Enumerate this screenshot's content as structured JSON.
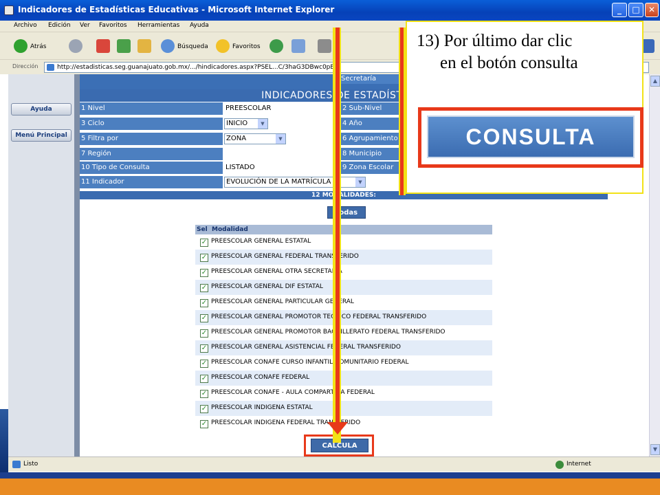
{
  "window": {
    "title": "Indicadores de Estadísticas Educativas - Microsoft Internet Explorer"
  },
  "menu": [
    "Archivo",
    "Edición",
    "Ver",
    "Favoritos",
    "Herramientas",
    "Ayuda"
  ],
  "toolbar": {
    "back": "Atrás",
    "search": "Búsqueda",
    "favorites": "Favoritos"
  },
  "address": {
    "label": "Dirección",
    "url": "http://estadisticas.seg.guanajuato.gob.mx/.../hindicadores.aspx?PSEL...C/3haG3DBwc0pEE"
  },
  "nav": {
    "help": "Ayuda",
    "main_menu": "Menú Principal"
  },
  "page": {
    "secretaria": "Secretaría",
    "header": "INDICADORES DE ESTADÍSTICAS",
    "rows": [
      {
        "label": "1 Nivel",
        "value": "PREESCOLAR",
        "right": "2 Sub-Nivel"
      },
      {
        "label": "3 Ciclo",
        "value": "INICIO",
        "right": "4 Año"
      },
      {
        "label": "5 Filtra por",
        "value": "ZONA",
        "right": "6 Agrupamiento"
      },
      {
        "label": "7 Región",
        "value": "",
        "right": "8 Municipio"
      },
      {
        "label": "10 Tipo de Consulta",
        "value": "LISTADO",
        "right": "9 Zona Escolar"
      },
      {
        "label": "11 Indicador",
        "value": "EVOLUCIÓN DE LA MATRÍCULA",
        "right": ""
      }
    ],
    "modalidades_header": "12 MODALIDADES:",
    "todas": "Todas",
    "table_header": {
      "sel": "Sel",
      "modalidad": "Modalidad"
    },
    "modalidades": [
      "PREESCOLAR GENERAL ESTATAL",
      "PREESCOLAR GENERAL FEDERAL TRANSFERIDO",
      "PREESCOLAR GENERAL OTRA SECRETARIA",
      "PREESCOLAR GENERAL DIF ESTATAL",
      "PREESCOLAR GENERAL PARTICULAR GENERAL",
      "PREESCOLAR GENERAL PROMOTOR TECNICO FEDERAL TRANSFERIDO",
      "PREESCOLAR GENERAL PROMOTOR BACHILLERATO FEDERAL TRANSFERIDO",
      "PREESCOLAR GENERAL ASISTENCIAL FEDERAL TRANSFERIDO",
      "PREESCOLAR CONAFE CURSO INFANTIL COMUNITARIO FEDERAL",
      "PREESCOLAR CONAFE FEDERAL",
      "PREESCOLAR CONAFE - AULA COMPARTIDA FEDERAL",
      "PREESCOLAR INDIGENA ESTATAL",
      "PREESCOLAR INDIGENA FEDERAL TRANSFERIDO"
    ],
    "calcula": "CALCULA"
  },
  "callout": {
    "line1": "13) Por último dar clic",
    "line2": "en el botón consulta",
    "button": "CONSULTA"
  },
  "status": {
    "text": "Listo",
    "zone": "Internet"
  }
}
